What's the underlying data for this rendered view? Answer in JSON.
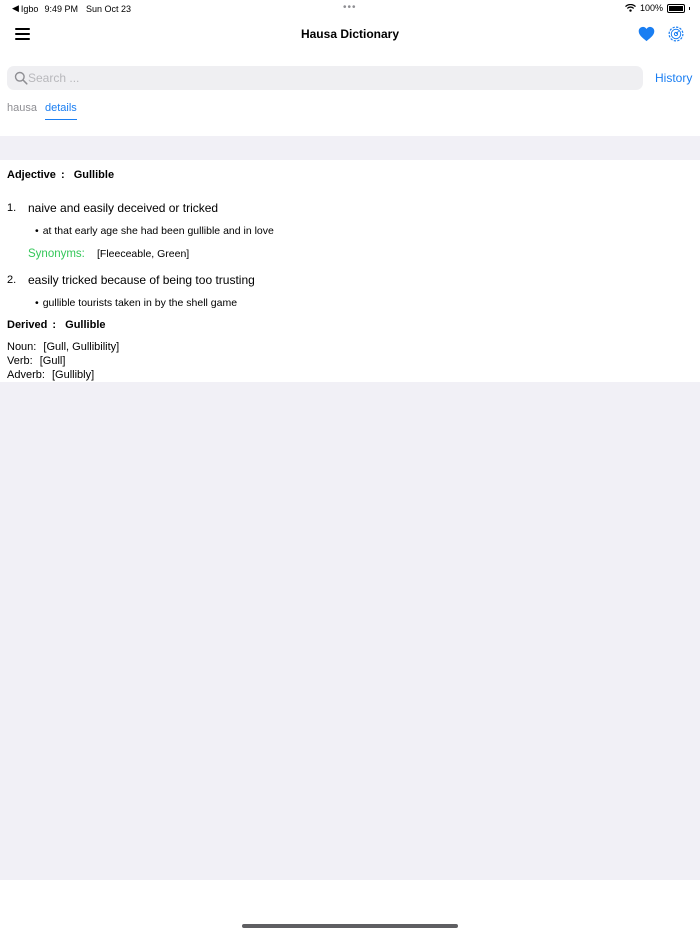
{
  "status_bar": {
    "back_app": "Igbo",
    "time": "9:49 PM",
    "date": "Sun Oct 23",
    "battery": "100%"
  },
  "nav": {
    "title": "Hausa Dictionary",
    "icons": [
      "menu-icon",
      "heart-icon",
      "settings-icon"
    ]
  },
  "search": {
    "placeholder": "Search ...",
    "value": "",
    "history_label": "History"
  },
  "tabs": [
    {
      "label": "hausa",
      "active": false
    },
    {
      "label": "details",
      "active": true
    }
  ],
  "entry": {
    "pos": "Adjective",
    "colon": ":",
    "word": "Gullible",
    "definitions": [
      {
        "number": "1.",
        "text": "naive and easily deceived or tricked",
        "example": "at that early age she had been gullible and in love",
        "synonyms_label": "Synonyms:",
        "synonyms": "[Fleeceable, Green]"
      },
      {
        "number": "2.",
        "text": "easily tricked because of being too trusting",
        "example": "gullible tourists taken in by the shell game"
      }
    ],
    "derived_label": "Derived",
    "derived_word": "Gullible",
    "derived_forms": [
      {
        "label": "Noun:",
        "value": "[Gull, Gullibility]"
      },
      {
        "label": "Verb:",
        "value": "[Gull]"
      },
      {
        "label": "Adverb:",
        "value": "[Gullibly]"
      }
    ]
  },
  "colors": {
    "accent": "#1a7ef2",
    "synonym": "#34c759",
    "grey_bg": "#f1f0f6"
  }
}
